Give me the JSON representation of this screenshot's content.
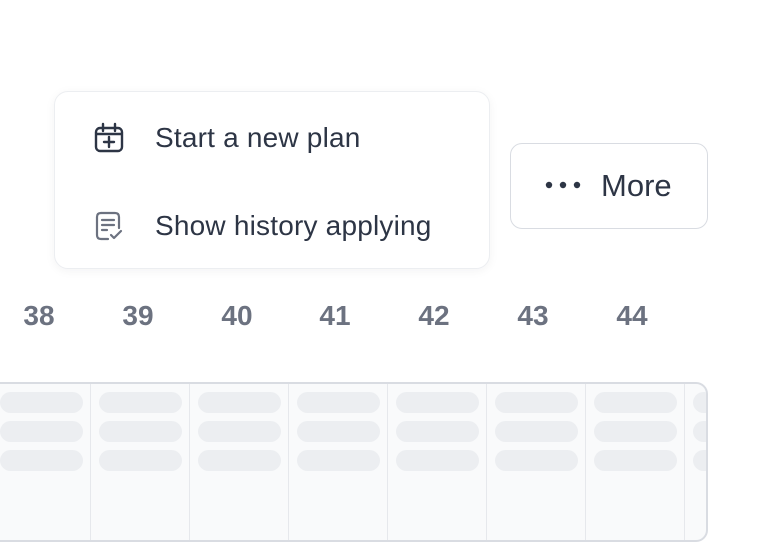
{
  "menu": {
    "items": [
      {
        "label": "Start a new plan",
        "icon": "calendar-plus-icon"
      },
      {
        "label": "Show history applying",
        "icon": "document-check-icon"
      }
    ]
  },
  "more_button": {
    "label": "More",
    "icon": "more-dots-icon"
  },
  "weeks": [
    "38",
    "39",
    "40",
    "41",
    "42",
    "43",
    "44"
  ],
  "colors": {
    "text": "#2d3545",
    "muted": "#6c7280",
    "border": "#d9dce2",
    "skeleton": "#eceef1",
    "grid_bg": "#f9fafb"
  }
}
